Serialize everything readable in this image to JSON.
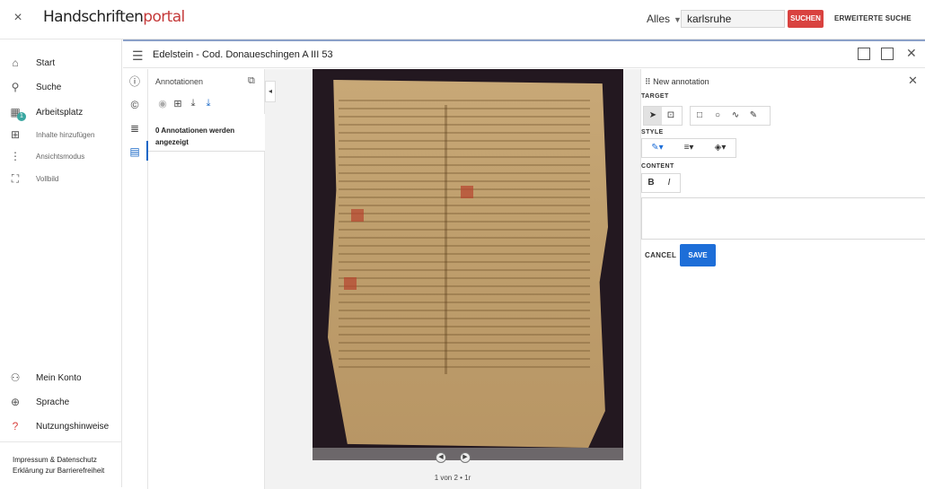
{
  "header": {
    "close_label": "×",
    "logo_main": "Handschriften",
    "logo_accent": "portal",
    "scope_label": "Alles",
    "search_value": "karlsruhe",
    "search_button": "SUCHEN",
    "advanced_search": "ERWEITERTE SUCHE"
  },
  "sidebar": {
    "items": [
      {
        "label": "Start",
        "icon": "home-icon",
        "glyph": "⌂"
      },
      {
        "label": "Suche",
        "icon": "search-icon",
        "glyph": "⚲"
      },
      {
        "label": "Arbeitsplatz",
        "icon": "workspace-icon",
        "glyph": "▦"
      },
      {
        "label": "Inhalte hinzufügen",
        "icon": "add-content-icon",
        "glyph": "⊞"
      },
      {
        "label": "Ansichtsmodus",
        "icon": "view-mode-icon",
        "glyph": "⋮"
      },
      {
        "label": "Vollbild",
        "icon": "fullscreen-icon",
        "glyph": "⛶"
      }
    ],
    "workspace_badge": "1",
    "bottom_items": [
      {
        "label": "Mein Konto",
        "icon": "account-icon",
        "glyph": "⚇"
      },
      {
        "label": "Sprache",
        "icon": "language-icon",
        "glyph": "⊕"
      },
      {
        "label": "Nutzungshinweise",
        "icon": "help-icon",
        "glyph": "?"
      }
    ],
    "footer": {
      "line1": "Impressum & Datenschutz",
      "line2": "Erklärung zur Barrierefreiheit"
    }
  },
  "viewer": {
    "title": "Edelstein - Cod. Donaueschingen A III 53",
    "annotations": {
      "panel_title": "Annotationen",
      "count_text": "0 Annotationen werden angezeigt"
    },
    "page_label": "1 von 2 • 1r"
  },
  "annotation_editor": {
    "title": "New annotation",
    "target_label": "TARGET",
    "style_label": "STYLE",
    "content_label": "CONTENT",
    "cancel_label": "CANCEL",
    "save_label": "SAVE",
    "bold_label": "B",
    "italic_label": "I"
  },
  "colors": {
    "accent": "#1d6ed8",
    "brand": "#d9423f",
    "badge": "#3aa7a1"
  }
}
